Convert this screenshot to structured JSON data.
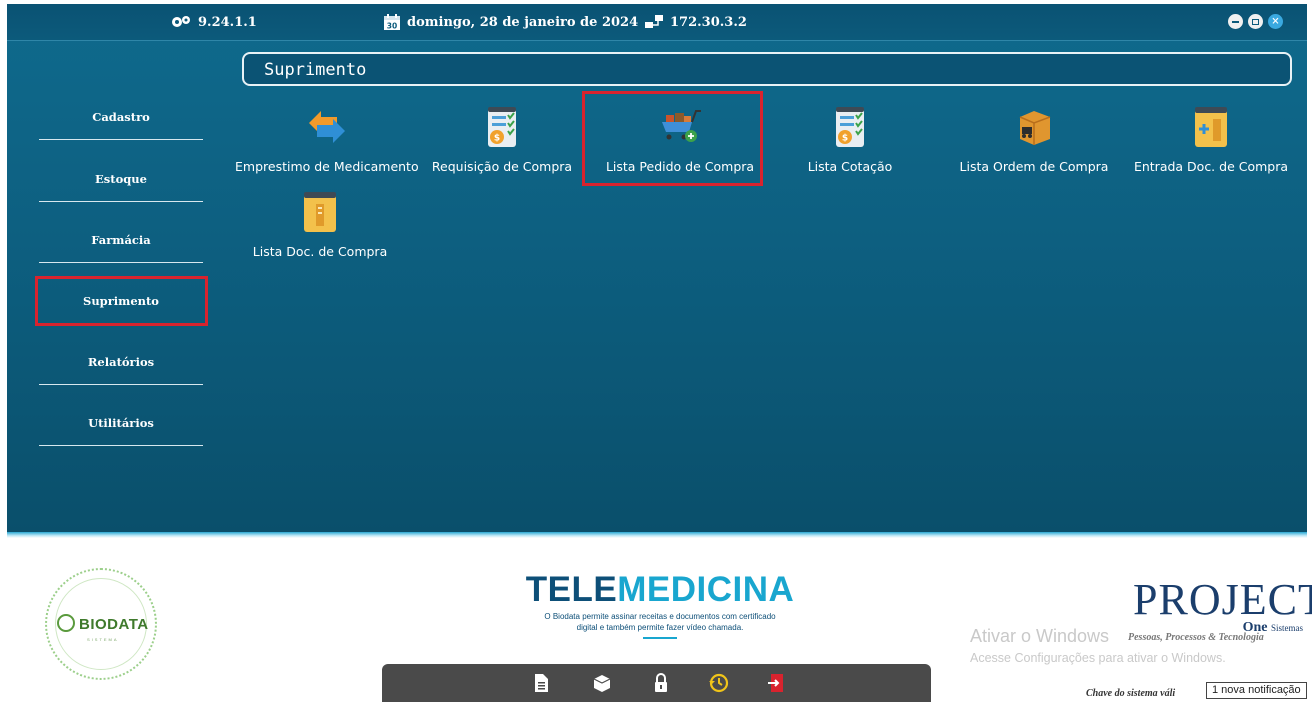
{
  "topbar": {
    "version": "9.24.1.1",
    "date": "domingo, 28 de janeiro de 2024",
    "ip": "172.30.3.2",
    "icons": [
      "gears-icon",
      "calendar-icon",
      "network-icon"
    ],
    "calendar_day": "30",
    "window_controls": [
      "minimize-icon",
      "restore-icon",
      "close-icon"
    ]
  },
  "module_title": "Suprimento",
  "sidebar": {
    "items": [
      {
        "label": "Cadastro"
      },
      {
        "label": "Estoque"
      },
      {
        "label": "Farmácia"
      },
      {
        "label": "Suprimento",
        "active": true
      },
      {
        "label": "Relatórios"
      },
      {
        "label": "Utilitários"
      }
    ]
  },
  "tiles": [
    {
      "label": "Emprestimo de Medicamento",
      "icon": "exchange-arrows-icon"
    },
    {
      "label": "Requisição de Compra",
      "icon": "checklist-coin-icon"
    },
    {
      "label": "Lista Pedido de Compra",
      "icon": "shopping-cart-icon",
      "highlighted": true
    },
    {
      "label": "Lista Cotação",
      "icon": "checklist-coin-icon"
    },
    {
      "label": "Lista Ordem de Compra",
      "icon": "delivery-box-icon"
    },
    {
      "label": "Entrada Doc. de Compra",
      "icon": "document-add-icon"
    },
    {
      "label": "Lista Doc. de Compra",
      "icon": "document-list-icon"
    }
  ],
  "footer": {
    "biodata": {
      "name": "BIODATA",
      "sub": "SISTEMA"
    },
    "telemedicina": {
      "title_a": "TELE",
      "title_b": "MEDICINA",
      "desc_line1": "O Biodata permite assinar receitas e documentos com certificado",
      "desc_line2": "digital e também permite fazer vídeo chamada."
    },
    "project": {
      "big": "PROJECT",
      "one": "One",
      "sistemas": "Sistemas",
      "tagline": "Pessoas, Processos & Tecnologia"
    },
    "activate_line1": "Ativar o Windows",
    "activate_line2": "Acesse Configurações para ativar o Windows.",
    "chave": "Chave do sistema váli",
    "notification": "1 nova notificação"
  },
  "dock": {
    "buttons": [
      "document-icon",
      "box-icon",
      "lock-icon",
      "history-icon",
      "exit-icon"
    ]
  },
  "colors": {
    "accent": "#0d5f80",
    "highlight": "#d9232e",
    "active_underline": "#e8d87c"
  }
}
